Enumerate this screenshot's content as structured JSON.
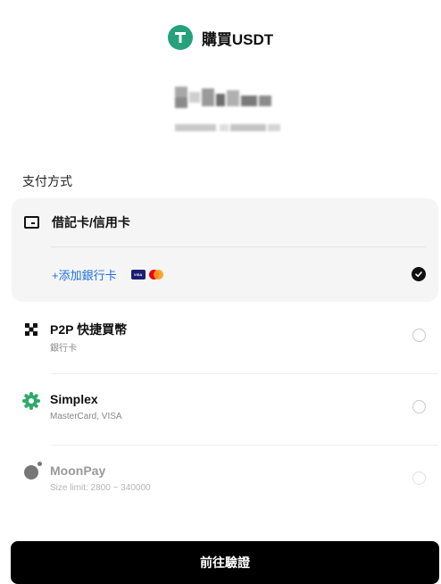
{
  "header": {
    "title": "購買USDT",
    "icon": "tether-icon",
    "accent": "#26a17b"
  },
  "amount": {
    "masked": true
  },
  "payment": {
    "section_label": "支付方式",
    "card": {
      "label": "借記卡/信用卡",
      "icon": "card-icon",
      "add_link": "+添加銀行卡",
      "badges": [
        "visa-icon",
        "mastercard-icon"
      ],
      "selected": true
    },
    "methods": [
      {
        "title": "P2P 快捷買幣",
        "subtitle": "銀行卡",
        "icon": "p2p-icon",
        "enabled": true,
        "selected": false
      },
      {
        "title": "Simplex",
        "subtitle": "MasterCard, VISA",
        "icon": "simplex-icon",
        "enabled": true,
        "selected": false
      },
      {
        "title": "MoonPay",
        "subtitle": "Size limit: 2800 ~ 340000",
        "icon": "moonpay-icon",
        "enabled": false,
        "selected": false
      }
    ]
  },
  "cta": {
    "label": "前往驗證"
  },
  "colors": {
    "link": "#1f6fe5",
    "panel": "#f5f5f5",
    "cta_bg": "#000000",
    "simplex_green": "#2eaa6b"
  }
}
